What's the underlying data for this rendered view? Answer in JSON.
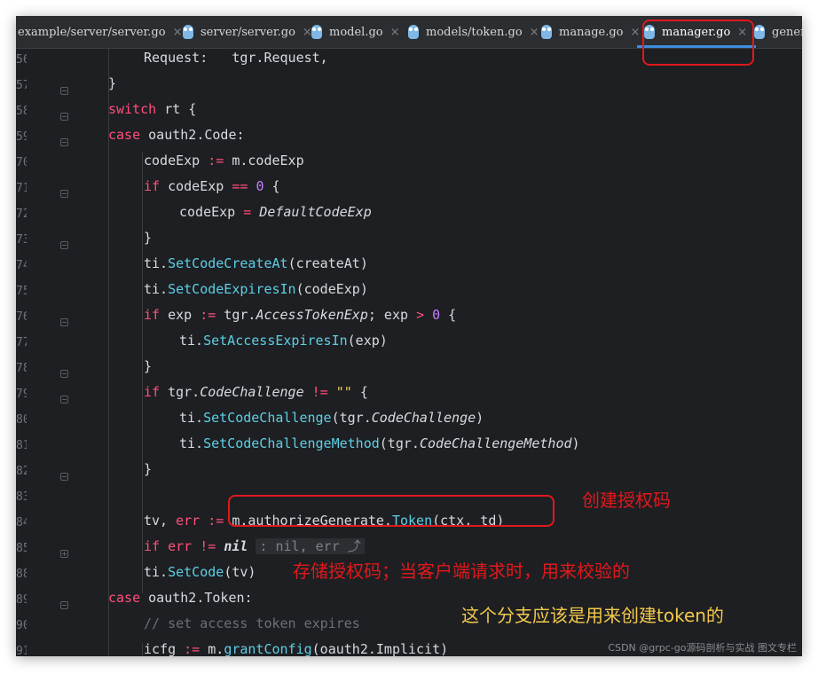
{
  "tabs": [
    {
      "label": "example/server/server.go",
      "active": false
    },
    {
      "label": "server/server.go",
      "active": false
    },
    {
      "label": "model.go",
      "active": false
    },
    {
      "label": "models/token.go",
      "active": false
    },
    {
      "label": "manage.go",
      "active": false
    },
    {
      "label": "manager.go",
      "active": true
    },
    {
      "label": "genera",
      "active": false
    }
  ],
  "close_glyph": "×",
  "line_numbers": [
    "56",
    "57",
    "58",
    "59",
    "70",
    "71",
    "72",
    "73",
    "74",
    "75",
    "76",
    "77",
    "78",
    "79",
    "80",
    "81",
    "82",
    "83",
    "84",
    "85",
    "88",
    "89",
    "90",
    "91"
  ],
  "code": {
    "l0": {
      "t1": "Request:",
      "t2": "tgr.Request,"
    },
    "l1": {
      "t1": "}"
    },
    "l2": {
      "t1": "switch",
      "t2": " rt {"
    },
    "l3": {
      "t1": "case",
      "t2": " oauth2.Code:"
    },
    "l4": {
      "t1": "codeExp ",
      "t2": ":=",
      "t3": " m.codeExp"
    },
    "l5": {
      "t1": "if",
      "t2": " codeExp ",
      "t3": "==",
      "t4": " ",
      "t5": "0",
      "t6": " {"
    },
    "l6": {
      "t1": "codeExp ",
      "t2": "=",
      "t3": " ",
      "t4": "DefaultCodeExp"
    },
    "l7": {
      "t1": "}"
    },
    "l8": {
      "t1": "ti.",
      "t2": "SetCodeCreateAt",
      "t3": "(createAt)"
    },
    "l9": {
      "t1": "ti.",
      "t2": "SetCodeExpiresIn",
      "t3": "(codeExp)"
    },
    "l10": {
      "t1": "if",
      "t2": " exp ",
      "t3": ":=",
      "t4": " tgr.",
      "t5": "AccessTokenExp",
      "t6": "; exp ",
      "t7": ">",
      "t8": " ",
      "t9": "0",
      "t10": " {"
    },
    "l11": {
      "t1": "ti.",
      "t2": "SetAccessExpiresIn",
      "t3": "(exp)"
    },
    "l12": {
      "t1": "}"
    },
    "l13": {
      "t1": "if",
      "t2": " tgr.",
      "t3": "CodeChallenge",
      "t4": " ",
      "t5": "!=",
      "t6": " ",
      "t7": "\"\"",
      "t8": " {"
    },
    "l14": {
      "t1": "ti.",
      "t2": "SetCodeChallenge",
      "t3": "(tgr.",
      "t4": "CodeChallenge",
      "t5": ")"
    },
    "l15": {
      "t1": "ti.",
      "t2": "SetCodeChallengeMethod",
      "t3": "(tgr.",
      "t4": "CodeChallengeMethod",
      "t5": ")"
    },
    "l16": {
      "t1": "}"
    },
    "l17": {
      "t1": ""
    },
    "l18": {
      "t1": "tv, ",
      "t2": "err",
      "t3": " ",
      "t4": ":=",
      "t5": " m.authorizeGenerate.",
      "t6": "Token",
      "t7": "(ctx, td)"
    },
    "l19": {
      "t1": "if",
      "t2": " ",
      "t3": "err",
      "t4": " ",
      "t5": "!=",
      "t6": " ",
      "t7": "nil",
      "t8": " ",
      "t9": ": nil, err ⤴"
    },
    "l20": {
      "t1": "ti.",
      "t2": "SetCode",
      "t3": "(tv)"
    },
    "l21": {
      "t1": "case",
      "t2": " oauth2.Token:"
    },
    "l22": {
      "t1": "// set access token expires"
    },
    "l23": {
      "t1": "icfg",
      "t2": " ",
      "t3": ":=",
      "t4": " m.",
      "t5": "grantConfig",
      "t6": "(oauth2.Implicit)"
    }
  },
  "annotations": {
    "create_code": "创建授权码",
    "store_code": "存储授权码；当客户端请求时，用来校验的",
    "token_branch": "这个分支应该是用来创建token的"
  },
  "annotation_colors": {
    "red": "#e0191c",
    "yellow": "#f2c94c"
  },
  "watermark": "CSDN @grpc-go源码剖析与实战 图文专栏"
}
